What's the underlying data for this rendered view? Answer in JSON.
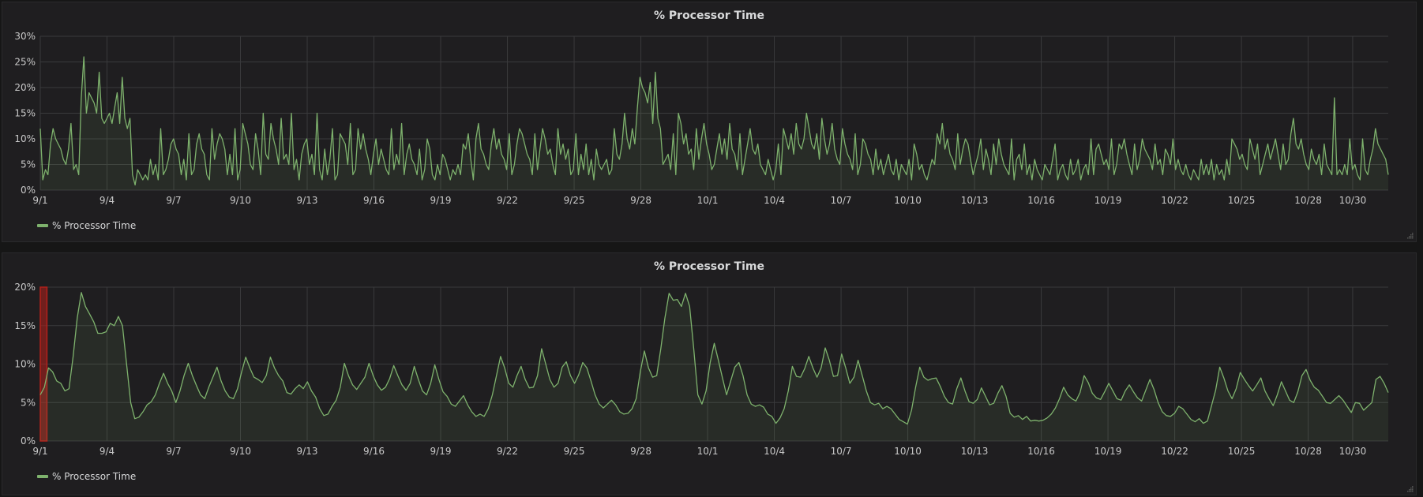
{
  "colors": {
    "series": "#7eb26d",
    "grid": "#3a3a3c",
    "fill": "rgba(126,178,109,0.10)",
    "threshold": "#b3201b"
  },
  "chart_data": [
    {
      "type": "area",
      "title": "% Processor Time",
      "legend": {
        "entries": [
          "% Processor Time"
        ],
        "placement": "bottom-left"
      },
      "xlabel": "",
      "ylabel": "",
      "ylim": [
        0,
        30
      ],
      "y_ticks": [
        "0%",
        "5%",
        "10%",
        "15%",
        "20%",
        "25%",
        "30%"
      ],
      "y_tick_values": [
        0,
        5,
        10,
        15,
        20,
        25,
        30
      ],
      "x_ticks": [
        "9/1",
        "9/4",
        "9/7",
        "9/10",
        "9/13",
        "9/16",
        "9/19",
        "9/22",
        "9/25",
        "9/28",
        "10/1",
        "10/4",
        "10/7",
        "10/10",
        "10/13",
        "10/16",
        "10/19",
        "10/22",
        "10/25",
        "10/28",
        "10/30"
      ],
      "x_tick_days": [
        0,
        3,
        6,
        9,
        12,
        15,
        18,
        21,
        24,
        27,
        30,
        33,
        36,
        39,
        42,
        45,
        48,
        51,
        54,
        57,
        59
      ],
      "xlim_days": [
        0,
        60.6
      ],
      "grid": true,
      "series": [
        {
          "name": "% Processor Time",
          "x_step_days": 0.125,
          "values": [
            12,
            2,
            4,
            3,
            9,
            12,
            10,
            9,
            8,
            6,
            5,
            8,
            13,
            4,
            5,
            3,
            18,
            26,
            15,
            19,
            18,
            17,
            15,
            23,
            14,
            13,
            14,
            15,
            13,
            16,
            19,
            13,
            22,
            14,
            12,
            14,
            3,
            1,
            4,
            3,
            2,
            3,
            2,
            6,
            3,
            5,
            2,
            12,
            3,
            4,
            6,
            9,
            10,
            8,
            7,
            3,
            6,
            2,
            11,
            3,
            4,
            9,
            11,
            8,
            7,
            3,
            2,
            12,
            6,
            9,
            11,
            10,
            8,
            3,
            7,
            3,
            12,
            2,
            4,
            13,
            11,
            9,
            5,
            4,
            11,
            8,
            3,
            15,
            7,
            6,
            13,
            10,
            8,
            5,
            14,
            6,
            7,
            5,
            15,
            4,
            6,
            2,
            7,
            9,
            10,
            5,
            7,
            3,
            15,
            4,
            2,
            8,
            3,
            6,
            12,
            2,
            3,
            11,
            10,
            9,
            5,
            13,
            3,
            4,
            12,
            8,
            11,
            8,
            6,
            3,
            7,
            10,
            5,
            8,
            6,
            4,
            3,
            12,
            4,
            7,
            5,
            13,
            3,
            7,
            9,
            6,
            5,
            3,
            8,
            2,
            4,
            10,
            8,
            3,
            2,
            5,
            3,
            7,
            6,
            4,
            2,
            4,
            3,
            5,
            3,
            9,
            8,
            11,
            6,
            2,
            10,
            13,
            8,
            7,
            5,
            4,
            9,
            12,
            8,
            10,
            7,
            6,
            4,
            11,
            3,
            5,
            9,
            12,
            11,
            9,
            7,
            6,
            3,
            11,
            4,
            8,
            12,
            10,
            7,
            8,
            5,
            3,
            12,
            7,
            9,
            6,
            8,
            3,
            4,
            11,
            3,
            7,
            4,
            9,
            3,
            6,
            2,
            8,
            5,
            4,
            5,
            6,
            3,
            4,
            12,
            7,
            6,
            9,
            15,
            10,
            8,
            12,
            9,
            16,
            22,
            20,
            19,
            17,
            21,
            13,
            23,
            14,
            12,
            5,
            6,
            7,
            4,
            11,
            3,
            15,
            13,
            9,
            11,
            7,
            8,
            4,
            12,
            6,
            10,
            13,
            9,
            7,
            4,
            5,
            8,
            11,
            7,
            10,
            6,
            13,
            8,
            7,
            4,
            11,
            3,
            6,
            9,
            12,
            8,
            7,
            9,
            5,
            4,
            3,
            6,
            4,
            2,
            4,
            9,
            3,
            12,
            10,
            8,
            11,
            7,
            13,
            9,
            8,
            10,
            15,
            12,
            9,
            8,
            11,
            6,
            14,
            10,
            7,
            9,
            13,
            8,
            6,
            5,
            12,
            9,
            7,
            6,
            4,
            11,
            3,
            5,
            10,
            9,
            7,
            6,
            3,
            8,
            4,
            6,
            3,
            5,
            7,
            4,
            3,
            6,
            2,
            5,
            4,
            3,
            6,
            2,
            9,
            7,
            4,
            5,
            3,
            2,
            4,
            6,
            5,
            11,
            9,
            13,
            8,
            10,
            7,
            6,
            4,
            11,
            5,
            8,
            10,
            9,
            6,
            3,
            5,
            7,
            10,
            4,
            8,
            6,
            3,
            9,
            5,
            10,
            7,
            5,
            4,
            3,
            10,
            2,
            6,
            7,
            4,
            9,
            3,
            5,
            2,
            6,
            4,
            3,
            2,
            5,
            4,
            3,
            6,
            9,
            2,
            4,
            5,
            3,
            2,
            6,
            3,
            4,
            6,
            2,
            4,
            5,
            3,
            10,
            3,
            8,
            9,
            7,
            5,
            6,
            4,
            10,
            3,
            5,
            9,
            8,
            10,
            7,
            5,
            3,
            9,
            4,
            6,
            10,
            8,
            7,
            6,
            4,
            9,
            5,
            6,
            3,
            8,
            7,
            5,
            10,
            4,
            6,
            4,
            3,
            5,
            3,
            2,
            4,
            3,
            2,
            6,
            3,
            5,
            3,
            6,
            2,
            5,
            3,
            4,
            2,
            6,
            3,
            10,
            9,
            8,
            6,
            7,
            5,
            4,
            10,
            8,
            6,
            9,
            3,
            5,
            7,
            9,
            6,
            8,
            10,
            7,
            4,
            9,
            5,
            6,
            11,
            14,
            9,
            8,
            10,
            7,
            5,
            4,
            8,
            6,
            5,
            7,
            3,
            9,
            5,
            4,
            3,
            18,
            3,
            4,
            3,
            5,
            3,
            10,
            4,
            5,
            3,
            2,
            10,
            4,
            3,
            6,
            8,
            12,
            9,
            8,
            7,
            6,
            3
          ]
        }
      ]
    },
    {
      "type": "area",
      "title": "% Processor Time",
      "legend": {
        "entries": [
          "% Processor Time"
        ],
        "placement": "bottom-left"
      },
      "xlabel": "",
      "ylabel": "",
      "ylim": [
        0,
        20
      ],
      "y_ticks": [
        "0%",
        "5%",
        "10%",
        "15%",
        "20%"
      ],
      "y_tick_values": [
        0,
        5,
        10,
        15,
        20
      ],
      "x_ticks": [
        "9/1",
        "9/4",
        "9/7",
        "9/10",
        "9/13",
        "9/16",
        "9/19",
        "9/22",
        "9/25",
        "9/28",
        "10/1",
        "10/4",
        "10/7",
        "10/10",
        "10/13",
        "10/16",
        "10/19",
        "10/22",
        "10/25",
        "10/28",
        "10/30"
      ],
      "x_tick_days": [
        0,
        3,
        6,
        9,
        12,
        15,
        18,
        21,
        24,
        27,
        30,
        33,
        36,
        39,
        42,
        45,
        48,
        51,
        54,
        57,
        59
      ],
      "xlim_days": [
        0,
        60.6
      ],
      "grid": true,
      "threshold_region": {
        "from_day": 0,
        "to_day": 0.3,
        "color": "#b3201b"
      },
      "series": [
        {
          "name": "% Processor Time",
          "x_step_days": 0.25,
          "values": [
            6,
            7,
            9.5,
            9,
            7.8,
            7.5,
            6.5,
            6.8,
            11,
            16,
            19.3,
            17.5,
            16.5,
            15.5,
            14,
            14,
            14.2,
            15.3,
            15,
            16.2,
            15,
            10,
            5,
            2.9,
            3.1,
            3.8,
            4.7,
            5.1,
            6,
            7.5,
            8.8,
            7.5,
            6.5,
            5,
            6.5,
            8.5,
            10.1,
            8.5,
            7.2,
            6,
            5.5,
            7,
            8.3,
            9.6,
            7.8,
            6.5,
            5.7,
            5.5,
            6.8,
            9,
            10.9,
            9.5,
            8.3,
            8,
            7.6,
            8.5,
            10.9,
            9.5,
            8.5,
            7.8,
            6.3,
            6.1,
            6.8,
            7.3,
            6.8,
            7.7,
            6.5,
            5.7,
            4.2,
            3.3,
            3.5,
            4.5,
            5.3,
            7,
            10.1,
            8.5,
            7.3,
            6.7,
            7.5,
            8.3,
            10.1,
            8.5,
            7.3,
            6.6,
            7,
            8.1,
            9.8,
            8.5,
            7.3,
            6.6,
            7.5,
            9.7,
            8,
            6.5,
            6,
            7.5,
            9.9,
            8,
            6.4,
            5.8,
            4.8,
            4.5,
            5.2,
            5.9,
            4.7,
            3.8,
            3.2,
            3.5,
            3.2,
            4.2,
            6,
            8.5,
            11,
            9.5,
            7.5,
            7,
            8.5,
            9.7,
            8,
            6.9,
            7,
            8.5,
            12,
            10,
            8,
            7,
            7.5,
            9.6,
            10.3,
            8.5,
            7.5,
            8.6,
            10.2,
            9.5,
            7.8,
            6,
            4.8,
            4.3,
            4.8,
            5.3,
            4.7,
            3.8,
            3.5,
            3.6,
            4.2,
            5.5,
            9,
            11.7,
            9.5,
            8.3,
            8.5,
            12,
            16,
            19.2,
            18.3,
            18.4,
            17.5,
            19.2,
            17.5,
            12,
            6,
            4.8,
            6.5,
            10.2,
            12.7,
            10.5,
            8.2,
            6,
            7.8,
            9.6,
            10.2,
            8.5,
            6,
            4.8,
            4.5,
            4.7,
            4.4,
            3.5,
            3.2,
            2.3,
            3,
            4.2,
            6.5,
            9.7,
            8.4,
            8.3,
            9.4,
            11,
            9.5,
            8.3,
            9.5,
            12.1,
            10.5,
            8.4,
            8.5,
            11.3,
            9.5,
            7.5,
            8.3,
            10.5,
            8.5,
            6.5,
            5,
            4.7,
            4.9,
            4.2,
            4.5,
            4.2,
            3.5,
            2.8,
            2.5,
            2.2,
            4,
            7,
            9.6,
            8.3,
            7.9,
            8.1,
            8.2,
            7.1,
            5.8,
            5,
            4.8,
            6.8,
            8.2,
            6.5,
            5.1,
            4.9,
            5.4,
            6.9,
            5.8,
            4.7,
            4.9,
            6.2,
            7.2,
            5.8,
            3.6,
            3.1,
            3.3,
            2.8,
            3.2,
            2.6,
            2.7,
            2.6,
            2.7,
            3,
            3.5,
            4.3,
            5.5,
            7,
            6,
            5.5,
            5.2,
            6.3,
            8.5,
            7.6,
            6.2,
            5.6,
            5.4,
            6.4,
            7.5,
            6.5,
            5.5,
            5.3,
            6.5,
            7.3,
            6.4,
            5.6,
            5.2,
            6.6,
            8,
            6.7,
            5,
            3.8,
            3.3,
            3.2,
            3.6,
            4.5,
            4.2,
            3.5,
            2.8,
            2.5,
            2.9,
            2.3,
            2.6,
            4.6,
            6.6,
            9.6,
            8.2,
            6.5,
            5.5,
            6.8,
            8.9,
            8,
            7.2,
            6.5,
            7.3,
            8.2,
            6.5,
            5.5,
            4.6,
            6,
            7.7,
            6.5,
            5.3,
            5,
            6.4,
            8.5,
            9.3,
            7.9,
            7,
            6.6,
            5.8,
            5,
            4.9,
            5.4,
            5.9,
            5.3,
            4.5,
            3.7,
            5,
            4.9,
            4,
            4.5,
            5,
            8,
            8.4,
            7.5,
            6.3
          ]
        }
      ]
    }
  ]
}
